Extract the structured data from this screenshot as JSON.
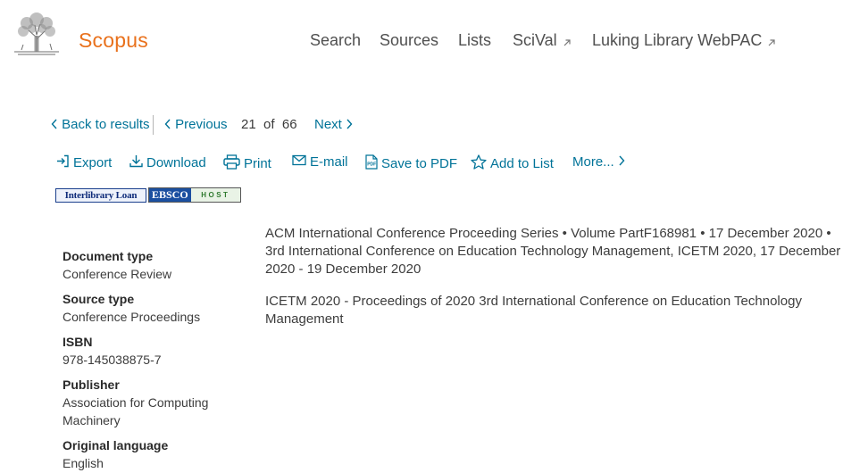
{
  "header": {
    "brand": "Scopus",
    "nav": [
      "Search",
      "Sources",
      "Lists",
      "SciVal",
      "Luking Library WebPAC"
    ]
  },
  "result_nav": {
    "back": "Back to results",
    "previous": "Previous",
    "current": "21",
    "of": "of",
    "total": "66",
    "next": "Next"
  },
  "toolbar": {
    "export": "Export",
    "download": "Download",
    "print": "Print",
    "email": "E-mail",
    "save_pdf": "Save to PDF",
    "add_list": "Add to List",
    "more": "More..."
  },
  "library_links": {
    "interlibrary": "Interlibrary Loan",
    "ebsco_left": "EBSCO",
    "ebsco_right": "HOST"
  },
  "source": {
    "line1": "ACM International Conference Proceeding Series  •  Volume PartF168981  •  17 December 2020  •",
    "line2": "3rd International Conference on Education Technology Management, ICETM 2020, 17 December",
    "line3": "2020 - 19 December 2020",
    "title_line1": "ICETM 2020 - Proceedings of 2020 3rd International Conference on Education Technology",
    "title_line2": "Management"
  },
  "details": {
    "doc_type_label": "Document type",
    "doc_type_value": "Conference Review",
    "source_type_label": "Source type",
    "source_type_value": "Conference Proceedings",
    "isbn_label": "ISBN",
    "isbn_value": "978-145038875-7",
    "publisher_label": "Publisher",
    "publisher_value": "Association for Computing Machinery",
    "language_label": "Original language",
    "language_value": "English"
  },
  "colors": {
    "brand": "#e9711c",
    "link": "#007398"
  },
  "icons": [
    "elsevier-tree-logo",
    "external-link-icon",
    "chevron-left-icon",
    "chevron-right-icon",
    "export-icon",
    "download-icon",
    "print-icon",
    "email-icon",
    "pdf-icon",
    "star-icon"
  ]
}
